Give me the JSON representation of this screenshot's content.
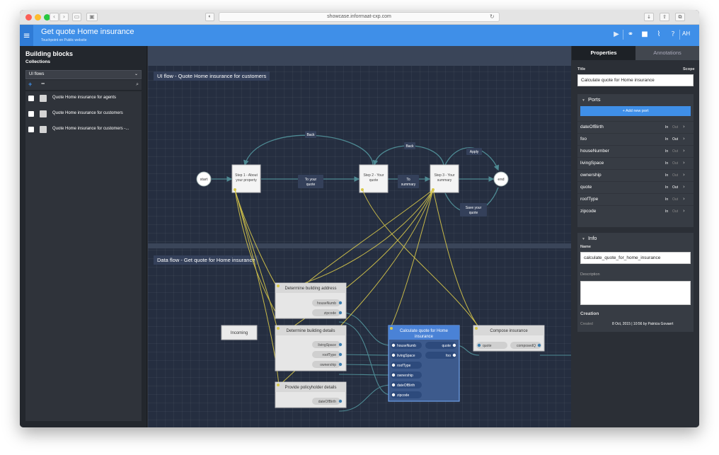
{
  "browser": {
    "url": "showcase.informaat-cxp.com"
  },
  "header": {
    "title": "Get quote Home insurance",
    "subtitle": "Touchpoint on Public website",
    "user_initials": "AH"
  },
  "left_panel": {
    "title": "Building blocks",
    "subtitle": "Collections",
    "select_value": "UI flows",
    "items": [
      {
        "label": "Quote Home insurance for agents"
      },
      {
        "label": "Quote Home insurance for customers"
      },
      {
        "label": "Quote Home insurance for customers -..."
      }
    ]
  },
  "canvas": {
    "ui_flow_label": "UI flow  -  Quote Home insurance for customers",
    "data_flow_label": "Data flow  -  Get quote for Home insurance",
    "ui_nodes": {
      "start": "start",
      "end": "end",
      "step1": [
        "Step 1 - About",
        "your property"
      ],
      "step2": [
        "Step 2 - Your",
        "quote"
      ],
      "step3": [
        "Step 3 - Your",
        "summary"
      ]
    },
    "ui_edges": {
      "back1": "Back",
      "back2": "Back",
      "apply": "Apply",
      "to_quote": [
        "To your",
        "quote"
      ],
      "to_summary": [
        "To",
        "summary"
      ],
      "save_quote": [
        "Save your",
        "quote"
      ]
    },
    "data_nodes": {
      "incoming": "Incoming",
      "address": {
        "title": "Determine building address",
        "ports": [
          "houseNumb",
          "zipcode"
        ]
      },
      "details": {
        "title": "Determine building details",
        "ports": [
          "livingSpace",
          "roofType",
          "ownership"
        ]
      },
      "policyholder": {
        "title": "Provide policyholder details",
        "ports": [
          "dateOfBirth"
        ]
      },
      "calculate": {
        "title": [
          "Calculate quote for Home",
          "insurance"
        ],
        "in_ports": [
          "houseNumb",
          "livingSpace",
          "roofType",
          "ownership",
          "dateOfBirth",
          "zipcode"
        ],
        "out_ports": [
          "quote",
          "foo"
        ]
      },
      "compose": {
        "title": "Compose insurance",
        "in_port": "quote",
        "out_port": "composedQ"
      }
    }
  },
  "right_panel": {
    "tabs": [
      "Properties",
      "Annotations"
    ],
    "title_label": "Title",
    "scope_label": "Scope",
    "title_value": "Calculate quote for Home insurance",
    "ports_header": "Ports",
    "add_port": "+ Add new port",
    "in_label": "In",
    "out_label": "Out",
    "ports": [
      {
        "name": "dateOfBirth"
      },
      {
        "name": "foo"
      },
      {
        "name": "houseNumber"
      },
      {
        "name": "livingSpace"
      },
      {
        "name": "ownership"
      },
      {
        "name": "quote"
      },
      {
        "name": "roofType"
      },
      {
        "name": "zipcode"
      }
    ],
    "info_header": "Info",
    "name_label": "Name",
    "name_value": "calculate_quote_for_home_insurance",
    "description_label": "Description",
    "creation_header": "Creation",
    "created_label": "Created",
    "created_value": "8 Oct, 2015 | 10:56 by Patricia Govaert"
  },
  "colors": {
    "accent": "#3f8fe8",
    "canvas_bg": "#252e40",
    "ui_edge": "#4e8a93",
    "data_edge": "#4e8a93",
    "binding": "#d8c84a",
    "node_selected": "#4a82d6"
  }
}
